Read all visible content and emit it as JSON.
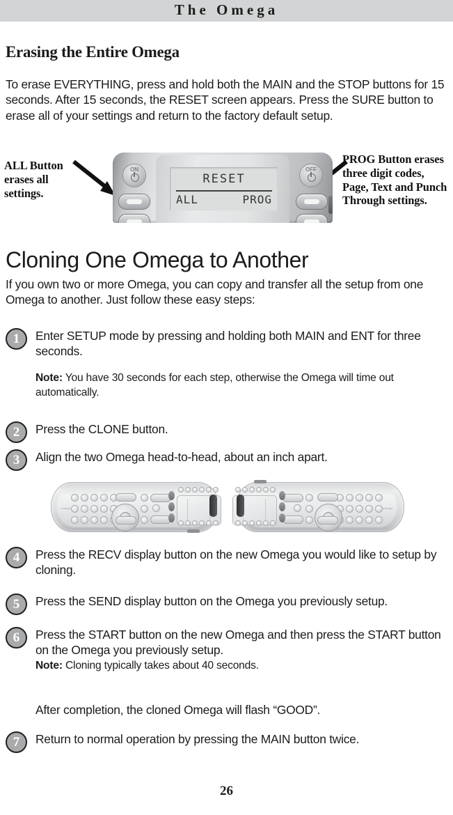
{
  "header": {
    "title": "The  Omega"
  },
  "section1": {
    "heading": "Erasing the Entire Omega",
    "paragraph": "To erase EVERYTHING, press and hold both the MAIN and the STOP buttons for 15 seconds. After 15 seconds, the RESET screen appears. Press the SURE button to erase all of your settings and return to the factory default setup."
  },
  "callouts": {
    "left": "ALL Button erases all settings.",
    "right_bold_lead": "PROG Button",
    "right_rest": " erases three digit codes, Page, Text and Punch Through settings."
  },
  "remote_top": {
    "power_on_label": "ON",
    "power_off_label": "OFF",
    "lcd": {
      "title": "RESET",
      "left_option": "ALL",
      "right_option": "PROG"
    }
  },
  "section2": {
    "heading": "Cloning One Omega to Another",
    "intro": "If you own two or more Omega, you can copy and transfer all the setup from one Omega to another. Just follow these easy steps:",
    "steps": [
      {
        "num": "1",
        "text": "Enter SETUP mode by pressing and holding both MAIN and ENT for three seconds."
      },
      {
        "num": "2",
        "text": "Press the CLONE button."
      },
      {
        "num": "3",
        "text": "Align the two Omega head-to-head, about an inch apart."
      },
      {
        "num": "4",
        "text": "Press the RECV display button on the new Omega you would like to setup by cloning."
      },
      {
        "num": "5",
        "text": "Press the SEND display button on the Omega you previously setup."
      },
      {
        "num": "6",
        "text": "Press the START button on the new Omega and then press the START button on the Omega you previously setup."
      },
      {
        "num": "7",
        "text": "Return to normal operation by pressing the MAIN button twice."
      }
    ],
    "note1_label": "Note:",
    "note1_text": " You have 30 seconds for each step, otherwise the Omega will time out automatically.",
    "note2_label": "Note:",
    "note2_text": " Cloning typically takes about 40 seconds.",
    "completion_text": "After completion, the cloned Omega will flash “GOOD”."
  },
  "footer": {
    "page_number": "26"
  }
}
